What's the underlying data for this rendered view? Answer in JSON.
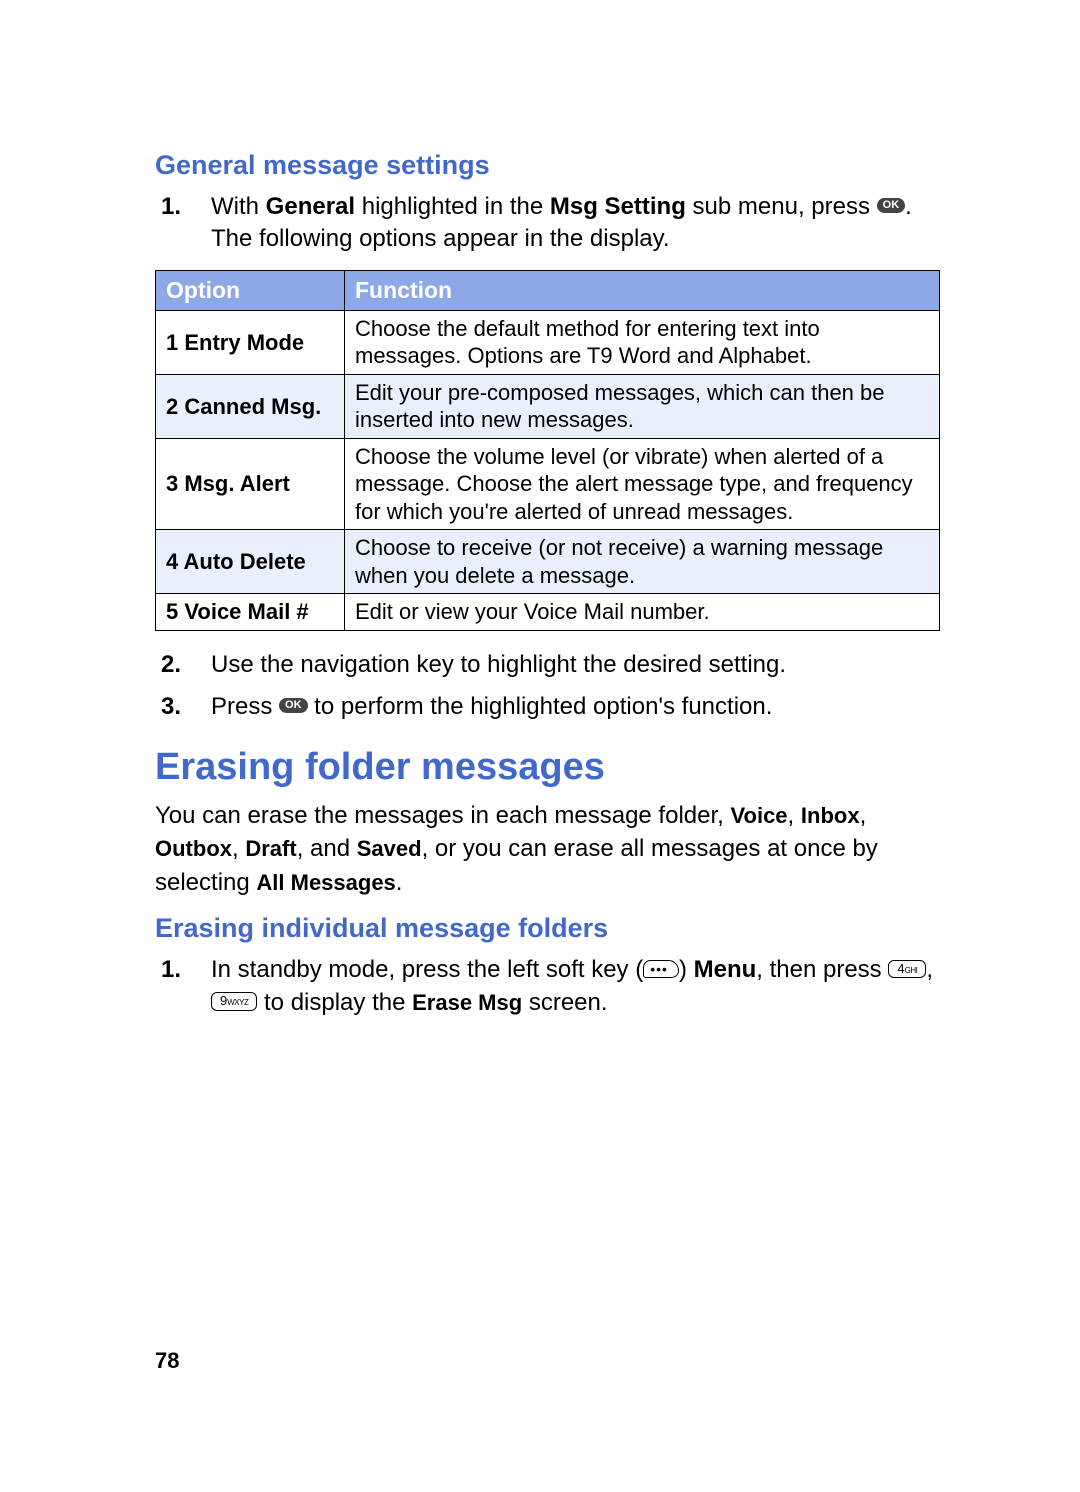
{
  "section1_heading": "General message settings",
  "step1": {
    "num": "1.",
    "text_a": "With ",
    "bold_a": "General",
    "text_b": " highlighted in the ",
    "bold_b": "Msg Setting",
    "text_c": " sub menu, press ",
    "text_d": ". The following options appear in the display."
  },
  "table": {
    "header_option": "Option",
    "header_function": "Function",
    "rows": [
      {
        "option": "1 Entry Mode",
        "function": "Choose the default method for entering text into messages. Options are T9 Word and Alphabet."
      },
      {
        "option": "2 Canned Msg.",
        "function": "Edit your pre-composed messages, which can then be inserted into new messages."
      },
      {
        "option": "3 Msg. Alert",
        "function": "Choose the volume level (or vibrate) when alerted of a message. Choose the alert message type, and frequency for which you're alerted of unread messages."
      },
      {
        "option": "4 Auto Delete",
        "function": "Choose to receive (or not receive) a warning message when you delete a message."
      },
      {
        "option": "5 Voice Mail #",
        "function": "Edit or view your Voice Mail number."
      }
    ]
  },
  "step2": {
    "num": "2.",
    "text": "Use the navigation key to highlight the desired setting."
  },
  "step3": {
    "num": "3.",
    "text_a": "Press ",
    "text_b": " to perform the highlighted option's function."
  },
  "section2_heading": "Erasing folder messages",
  "erase_para": {
    "a": "You can erase the messages in each message folder, ",
    "voice": "Voice",
    "comma1": ", ",
    "inbox": "Inbox",
    "comma2": ", ",
    "outbox": "Outbox",
    "comma3": ", ",
    "draft": "Draft",
    "and": ", and ",
    "saved": "Saved",
    "b": ", or you can erase all messages at once by selecting ",
    "all": "All Messages",
    "c": "."
  },
  "section3_heading": "Erasing individual message folders",
  "step_e1": {
    "num": "1.",
    "a": "In standby mode, press the left soft key (",
    "b": ") ",
    "menu": "Menu",
    "c": ", then press ",
    "d": ", ",
    "e": " to display the ",
    "erase": "Erase Msg",
    "f": " screen."
  },
  "keys": {
    "ok": "OK",
    "softkey_dots": "•••",
    "key4_main": "4",
    "key4_sub": "GHI",
    "key9_main": "9",
    "key9_sub": "WXYZ"
  },
  "page_number": "78"
}
